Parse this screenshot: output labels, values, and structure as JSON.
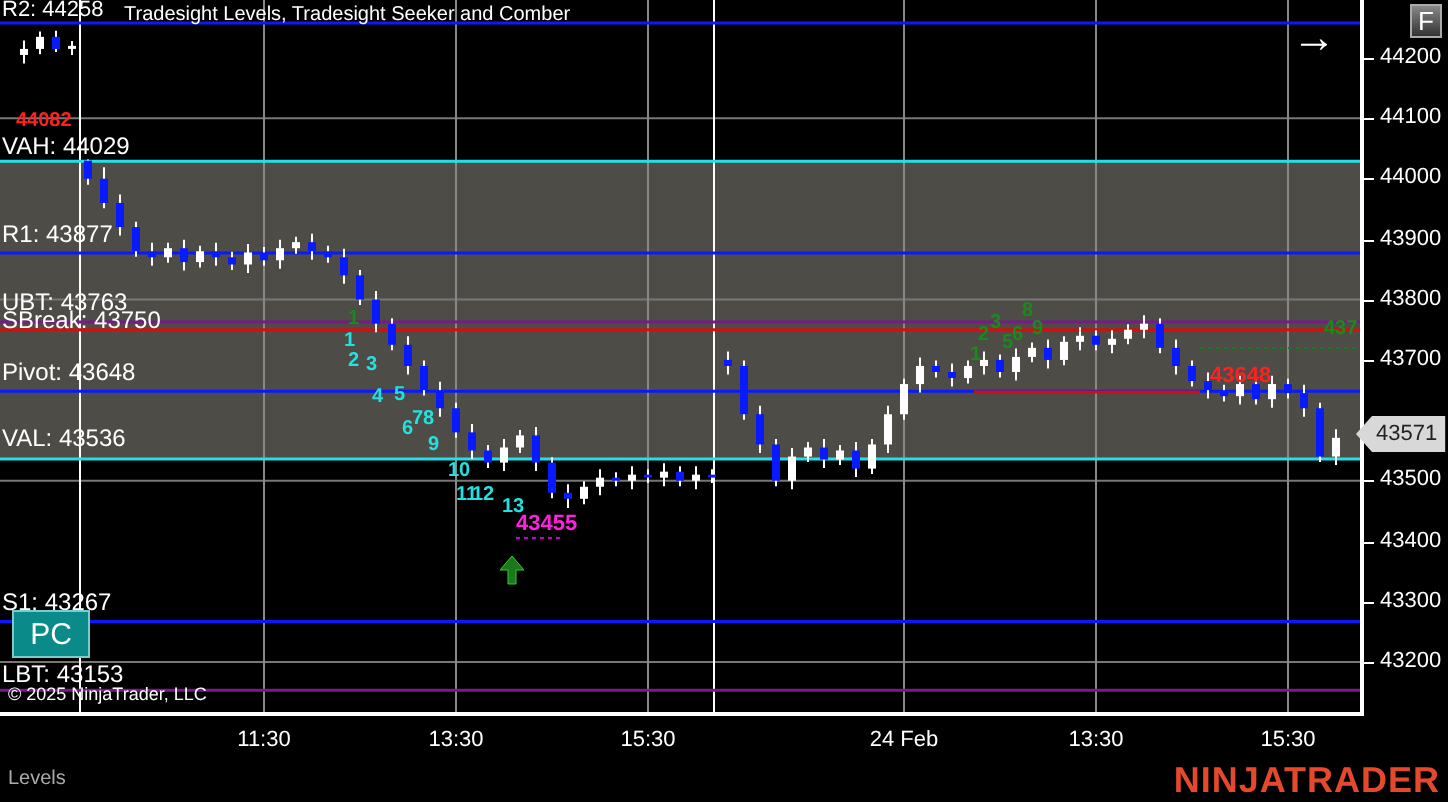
{
  "chart": {
    "title": "Tradesight Levels, Tradesight Seeker and Comber",
    "copyright": "© 2025 NinjaTrader, LLC",
    "pc_button": "PC",
    "f_button": "F",
    "jump_arrow": "→",
    "markers": [
      {
        "text": "44082",
        "kind": "price_high"
      },
      {
        "text": "1",
        "kind": "count"
      },
      {
        "text": "2",
        "kind": "count"
      },
      {
        "text": "3",
        "kind": "count"
      },
      {
        "text": "4",
        "kind": "count"
      },
      {
        "text": "5",
        "kind": "count"
      },
      {
        "text": "6",
        "kind": "count"
      },
      {
        "text": "78",
        "kind": "count"
      },
      {
        "text": "9",
        "kind": "count"
      },
      {
        "text": "10",
        "kind": "count"
      },
      {
        "text": "11",
        "kind": "count"
      },
      {
        "text": "12",
        "kind": "count"
      },
      {
        "text": "13",
        "kind": "count"
      },
      {
        "text": "43455",
        "kind": "price_low"
      },
      {
        "text": "43648",
        "kind": "price_high"
      },
      {
        "text": "1",
        "kind": "setup"
      },
      {
        "text": "1",
        "kind": "setup"
      },
      {
        "text": "2",
        "kind": "setup"
      },
      {
        "text": "3",
        "kind": "setup"
      },
      {
        "text": "5",
        "kind": "setup"
      },
      {
        "text": "6",
        "kind": "setup"
      },
      {
        "text": "8",
        "kind": "setup"
      },
      {
        "text": "9",
        "kind": "setup"
      },
      {
        "text": "437",
        "kind": "setup"
      }
    ],
    "chart_data": {
      "type": "candlestick",
      "categories": [
        null,
        null,
        null,
        null,
        null,
        null,
        null,
        null,
        null,
        null,
        null,
        null,
        null,
        null,
        null,
        "11:30",
        null,
        null,
        null,
        null,
        null,
        null,
        null,
        null,
        null,
        null,
        null,
        "13:30",
        null,
        null,
        null,
        null,
        null,
        null,
        null,
        null,
        null,
        null,
        null,
        "15:30",
        null,
        null,
        null,
        null,
        null,
        null,
        null,
        null,
        null,
        null,
        null,
        null,
        null,
        null,
        null,
        "24 Feb",
        null,
        null,
        null,
        null,
        null,
        null,
        null,
        null,
        null,
        null,
        null,
        "13:30",
        null,
        null,
        null,
        null,
        null,
        null,
        null,
        null,
        null,
        null,
        null,
        "15:30",
        null,
        null,
        null
      ],
      "ohlc": [
        [
          44205,
          44229,
          44191,
          44215
        ],
        [
          44215,
          44244,
          44206,
          44235
        ],
        [
          44235,
          44245,
          44210,
          44215
        ],
        [
          44215,
          44228,
          44205,
          44220
        ],
        [
          44030,
          44032,
          43990,
          44000
        ],
        [
          44000,
          44019,
          43951,
          43960
        ],
        [
          43960,
          43974,
          43906,
          43920
        ],
        [
          43920,
          43929,
          43871,
          43880
        ],
        [
          43880,
          43894,
          43856,
          43870
        ],
        [
          43870,
          43894,
          43861,
          43885
        ],
        [
          43885,
          43899,
          43848,
          43862
        ],
        [
          43862,
          43889,
          43853,
          43880
        ],
        [
          43880,
          43894,
          43856,
          43870
        ],
        [
          43870,
          43879,
          43849,
          43858
        ],
        [
          43858,
          43892,
          43844,
          43878
        ],
        [
          43878,
          43887,
          43856,
          43865
        ],
        [
          43865,
          43899,
          43851,
          43885
        ],
        [
          43885,
          43904,
          43876,
          43895
        ],
        [
          43895,
          43909,
          43866,
          43880
        ],
        [
          43880,
          43889,
          43861,
          43870
        ],
        [
          43870,
          43884,
          43826,
          43840
        ],
        [
          43840,
          43849,
          43791,
          43800
        ],
        [
          43800,
          43814,
          43746,
          43760
        ],
        [
          43760,
          43769,
          43716,
          43725
        ],
        [
          43725,
          43739,
          43676,
          43690
        ],
        [
          43690,
          43699,
          43641,
          43650
        ],
        [
          43650,
          43664,
          43606,
          43620
        ],
        [
          43620,
          43629,
          43571,
          43580
        ],
        [
          43580,
          43594,
          43536,
          43550
        ],
        [
          43550,
          43559,
          43521,
          43530
        ],
        [
          43530,
          43569,
          43516,
          43555
        ],
        [
          43555,
          43584,
          43546,
          43575
        ],
        [
          43575,
          43589,
          43516,
          43530
        ],
        [
          43530,
          43539,
          43471,
          43480
        ],
        [
          43480,
          43494,
          43455,
          43470
        ],
        [
          43470,
          43499,
          43461,
          43490
        ],
        [
          43490,
          43519,
          43476,
          43505
        ],
        [
          43505,
          43514,
          43491,
          43500
        ],
        [
          43500,
          43524,
          43486,
          43510
        ],
        [
          43510,
          43519,
          43496,
          43505
        ],
        [
          43505,
          43529,
          43491,
          43515
        ],
        [
          43515,
          43524,
          43491,
          43500
        ],
        [
          43500,
          43524,
          43486,
          43510
        ],
        [
          43510,
          43519,
          43496,
          43505
        ],
        [
          43700,
          43714,
          43676,
          43690
        ],
        [
          43690,
          43699,
          43601,
          43610
        ],
        [
          43610,
          43624,
          43546,
          43560
        ],
        [
          43560,
          43569,
          43491,
          43500
        ],
        [
          43500,
          43554,
          43486,
          43540
        ],
        [
          43540,
          43564,
          43531,
          43555
        ],
        [
          43555,
          43569,
          43521,
          43535
        ],
        [
          43535,
          43559,
          43526,
          43550
        ],
        [
          43550,
          43564,
          43506,
          43520
        ],
        [
          43520,
          43569,
          43511,
          43560
        ],
        [
          43560,
          43624,
          43546,
          43610
        ],
        [
          43610,
          43669,
          43601,
          43660
        ],
        [
          43660,
          43704,
          43646,
          43690
        ],
        [
          43690,
          43699,
          43671,
          43680
        ],
        [
          43680,
          43694,
          43656,
          43670
        ],
        [
          43670,
          43699,
          43661,
          43690
        ],
        [
          43690,
          43714,
          43676,
          43700
        ],
        [
          43700,
          43709,
          43671,
          43680
        ],
        [
          43680,
          43719,
          43666,
          43705
        ],
        [
          43705,
          43729,
          43696,
          43720
        ],
        [
          43720,
          43734,
          43686,
          43700
        ],
        [
          43700,
          43739,
          43691,
          43730
        ],
        [
          43730,
          43754,
          43716,
          43740
        ],
        [
          43740,
          43749,
          43716,
          43725
        ],
        [
          43725,
          43749,
          43711,
          43735
        ],
        [
          43735,
          43759,
          43726,
          43750
        ],
        [
          43750,
          43774,
          43736,
          43760
        ],
        [
          43760,
          43769,
          43711,
          43720
        ],
        [
          43720,
          43734,
          43676,
          43690
        ],
        [
          43690,
          43699,
          43656,
          43665
        ],
        [
          43665,
          43679,
          43636,
          43650
        ],
        [
          43650,
          43659,
          43631,
          43640
        ],
        [
          43640,
          43674,
          43626,
          43660
        ],
        [
          43660,
          43669,
          43626,
          43635
        ],
        [
          43635,
          43674,
          43621,
          43660
        ],
        [
          43660,
          43669,
          43636,
          43645
        ],
        [
          43645,
          43659,
          43606,
          43620
        ],
        [
          43620,
          43629,
          43531,
          43540
        ],
        [
          43540,
          43585,
          43526,
          43571
        ]
      ],
      "ylim": [
        43117,
        44296
      ],
      "yticks": [
        44200,
        44100,
        44000,
        43900,
        43800,
        43700,
        43500,
        43400,
        43300,
        43200
      ],
      "grid": true,
      "bands": [
        {
          "axis": "y",
          "from": 43536,
          "to": 44029,
          "color": "#4d4c46"
        }
      ],
      "ref_lines": [
        {
          "axis": "y",
          "value": 44258,
          "label": "R2: 44258",
          "color": "#0a1aff"
        },
        {
          "axis": "y",
          "value": 44029,
          "label": "VAH: 44029",
          "color": "#22e0e8"
        },
        {
          "axis": "y",
          "value": 43877,
          "label": "R1: 43877",
          "color": "#0a1aff"
        },
        {
          "axis": "y",
          "value": 43763,
          "label": "UBT: 43763",
          "color": "#7a1a8a"
        },
        {
          "axis": "y",
          "value": 43750,
          "label": "SBreak: 43750",
          "color": "#d01010"
        },
        {
          "axis": "y",
          "value": 43648,
          "label": "Pivot: 43648",
          "color": "#0a1aff"
        },
        {
          "axis": "y",
          "value": 43536,
          "label": "VAL: 43536",
          "color": "#22e0e8"
        },
        {
          "axis": "y",
          "value": 43267,
          "label": "S1: 43267",
          "color": "#0a1aff"
        },
        {
          "axis": "y",
          "value": 43153,
          "label": "LBT: 43153",
          "color": "#7a1a8a"
        }
      ]
    }
  },
  "price_axis": {
    "last_price": "43571"
  },
  "footer": {
    "tab": "Levels",
    "logo": "NINJATRADER"
  }
}
